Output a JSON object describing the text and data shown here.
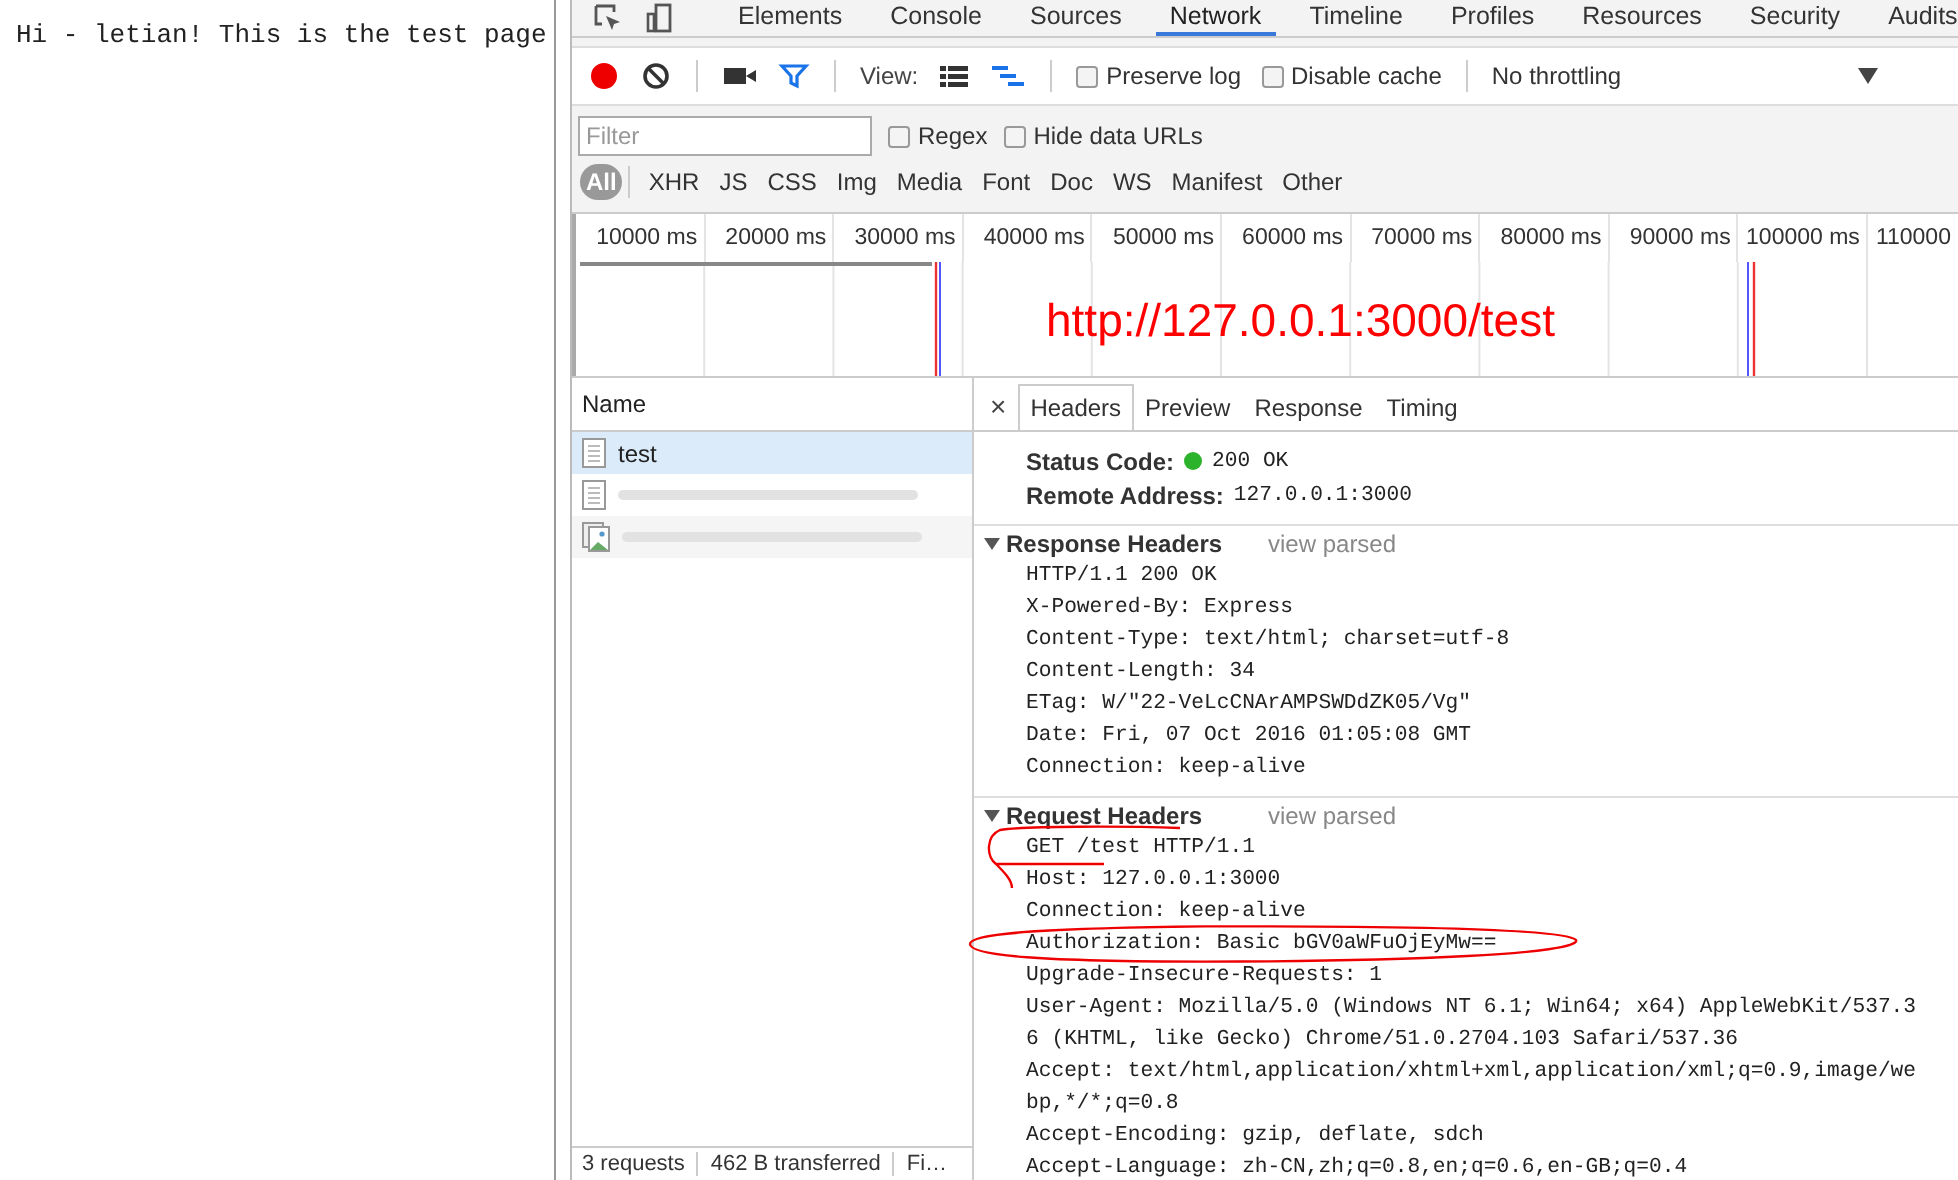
{
  "page": {
    "text": "Hi - letian! This is the test page"
  },
  "devtools": {
    "tabs": [
      {
        "label": "Elements",
        "selected": false
      },
      {
        "label": "Console",
        "selected": false
      },
      {
        "label": "Sources",
        "selected": false
      },
      {
        "label": "Network",
        "selected": true
      },
      {
        "label": "Timeline",
        "selected": false
      },
      {
        "label": "Profiles",
        "selected": false
      },
      {
        "label": "Resources",
        "selected": false
      },
      {
        "label": "Security",
        "selected": false
      },
      {
        "label": "Audits",
        "selected": false
      }
    ],
    "toolbar": {
      "recording": true,
      "filter_active": true,
      "view_label": "View:",
      "views": [
        {
          "kind": "list",
          "selected": false
        },
        {
          "kind": "waterfall",
          "selected": true
        }
      ],
      "checkboxes": [
        {
          "label": "Preserve log",
          "checked": false
        },
        {
          "label": "Disable cache",
          "checked": false
        }
      ],
      "throttling": "No throttling"
    },
    "filter_bar": {
      "placeholder": "Filter",
      "options": [
        {
          "label": "Regex",
          "checked": false
        },
        {
          "label": "Hide data URLs",
          "checked": false
        }
      ]
    },
    "types": [
      {
        "label": "All",
        "selected": true
      },
      {
        "label": "XHR",
        "selected": false
      },
      {
        "label": "JS",
        "selected": false
      },
      {
        "label": "CSS",
        "selected": false
      },
      {
        "label": "Img",
        "selected": false
      },
      {
        "label": "Media",
        "selected": false
      },
      {
        "label": "Font",
        "selected": false
      },
      {
        "label": "Doc",
        "selected": false
      },
      {
        "label": "WS",
        "selected": false
      },
      {
        "label": "Manifest",
        "selected": false
      },
      {
        "label": "Other",
        "selected": false
      }
    ],
    "timeline": {
      "ticks": [
        "10000 ms",
        "20000 ms",
        "30000 ms",
        "40000 ms",
        "50000 ms",
        "60000 ms",
        "70000 ms",
        "80000 ms",
        "90000 ms",
        "100000 ms",
        "110000"
      ]
    },
    "annotation": "http://127.0.0.1:3000/test",
    "requests": {
      "header": "Name",
      "rows": [
        {
          "kind": "document",
          "name": "test",
          "redacted": false,
          "selected": true
        },
        {
          "kind": "document",
          "redacted": true,
          "selected": false
        },
        {
          "kind": "image",
          "redacted": true,
          "selected": false
        }
      ]
    },
    "details": {
      "close": "×",
      "tabs": [
        {
          "label": "Headers",
          "selected": true
        },
        {
          "label": "Preview",
          "selected": false
        },
        {
          "label": "Response",
          "selected": false
        },
        {
          "label": "Timing",
          "selected": false
        }
      ],
      "general": [
        {
          "kind": "status",
          "key": "Status Code:",
          "value": "200 OK"
        },
        {
          "kind": "plain",
          "key": "Remote Address:",
          "value": "127.0.0.1:3000"
        }
      ],
      "sections": [
        {
          "title": "Response Headers",
          "action": "view parsed",
          "expanded": true,
          "lines": [
            "HTTP/1.1 200 OK",
            "X-Powered-By: Express",
            "Content-Type: text/html; charset=utf-8",
            "Content-Length: 34",
            "ETag: W/\"22-VeLcCNArAMPSWDdZK05/Vg\"",
            "Date: Fri, 07 Oct 2016 01:05:08 GMT",
            "Connection: keep-alive"
          ]
        },
        {
          "title": "Request Headers",
          "action": "view parsed",
          "expanded": true,
          "lines": [
            "GET /test HTTP/1.1",
            "Host: 127.0.0.1:3000",
            "Connection: keep-alive",
            "Authorization: Basic bGV0aWFuOjEyMw==",
            "Upgrade-Insecure-Requests: 1",
            "User-Agent: Mozilla/5.0 (Windows NT 6.1; Win64; x64) AppleWebKit/537.3",
            "6 (KHTML, like Gecko) Chrome/51.0.2704.103 Safari/537.36",
            "Accept: text/html,application/xhtml+xml,application/xml;q=0.9,image/we",
            "bp,*/*;q=0.8",
            "Accept-Encoding: gzip, deflate, sdch",
            "Accept-Language: zh-CN,zh;q=0.8,en;q=0.6,en-GB;q=0.4"
          ]
        }
      ]
    },
    "status_bar": [
      "3 requests",
      "462 B transferred",
      "Fi…"
    ]
  }
}
